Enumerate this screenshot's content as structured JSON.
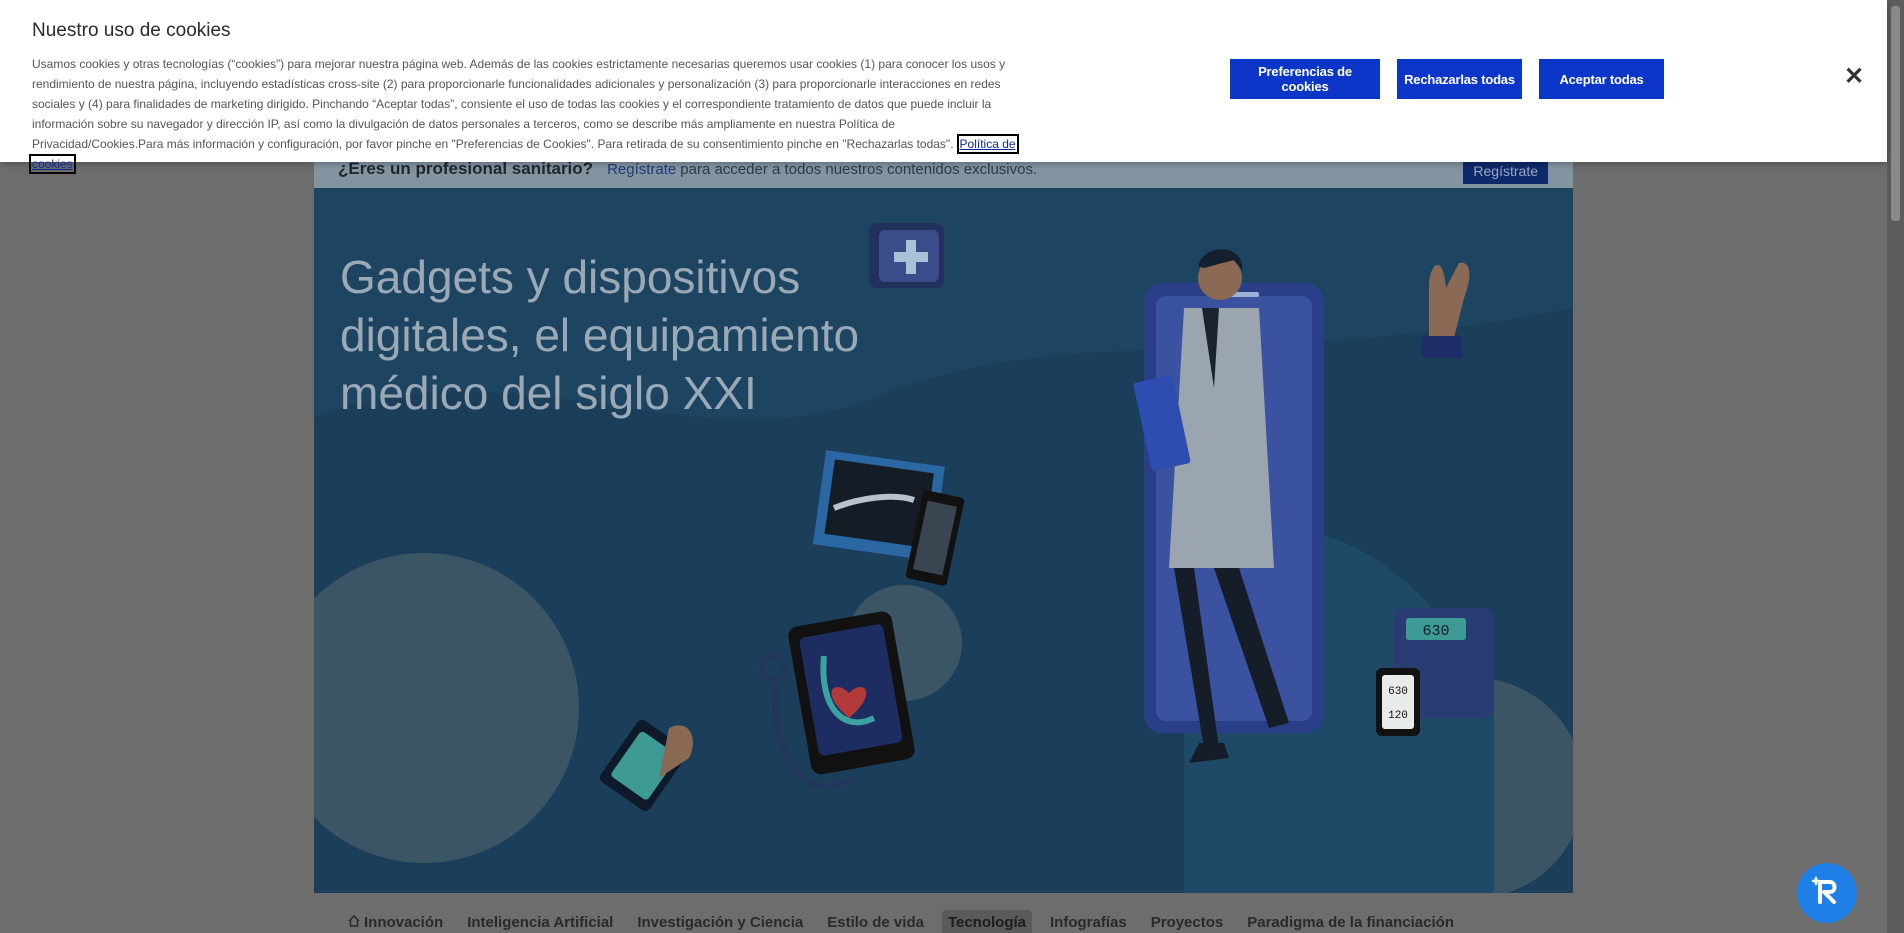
{
  "cookie": {
    "title": "Nuestro uso de cookies",
    "text": "Usamos cookies y otras tecnologías (“cookies”) para mejorar nuestra página web. Además de las cookies estrictamente necesarias queremos usar cookies (1) para conocer los usos y rendimiento de nuestra página, incluyendo estadísticas cross-site (2) para proporcionarle funcionalidades adicionales y personalización (3) para proporcionarle interacciones en redes sociales y (4) para finalidades de marketing dirigido. Pinchando “Aceptar todas”, consiente el uso de todas las cookies y el correspondiente tratamiento de datos que puede incluir la información sobre su navegador y dirección IP, así como la divulgación de datos personales a terceros, como se describe más ampliamente en nuestra Política de Privacidad/Cookies.Para más información y configuración, por favor pinche en \"Preferencias de Cookies\". Para retirada de su consentimiento pinche en \"Rechazarlas todas\".",
    "policy_link": "Política de cookies",
    "preferences_label": "Preferencias de cookies",
    "reject_label": "Rechazarlas todas",
    "accept_label": "Aceptar todas",
    "close_icon": "close-icon",
    "accent_color": "#0b36c8"
  },
  "pro_bar": {
    "question": "¿Eres un profesional sanitario?",
    "register_link": "Regístrate",
    "rest_text": "para acceder a todos nuestros contenidos exclusivos.",
    "register_button": "Regístrate"
  },
  "hero": {
    "title": "Gadgets y dispositivos digitales, el equipamiento médico del siglo XXI",
    "device_reading_1": "630",
    "device_reading_2": "630",
    "device_reading_3": "120"
  },
  "nav": {
    "items": [
      {
        "label": "Innovación",
        "icon": "home-icon"
      },
      {
        "label": "Inteligencia Artificial"
      },
      {
        "label": "Investigación y Ciencia"
      },
      {
        "label": "Estilo de vida"
      },
      {
        "label": "Tecnología"
      },
      {
        "label": "Infografías"
      },
      {
        "label": "Proyectos"
      },
      {
        "label": "Paradigma de la financiación"
      }
    ],
    "active": "Tecnología"
  },
  "help_fab_icon": "assistant-icon"
}
